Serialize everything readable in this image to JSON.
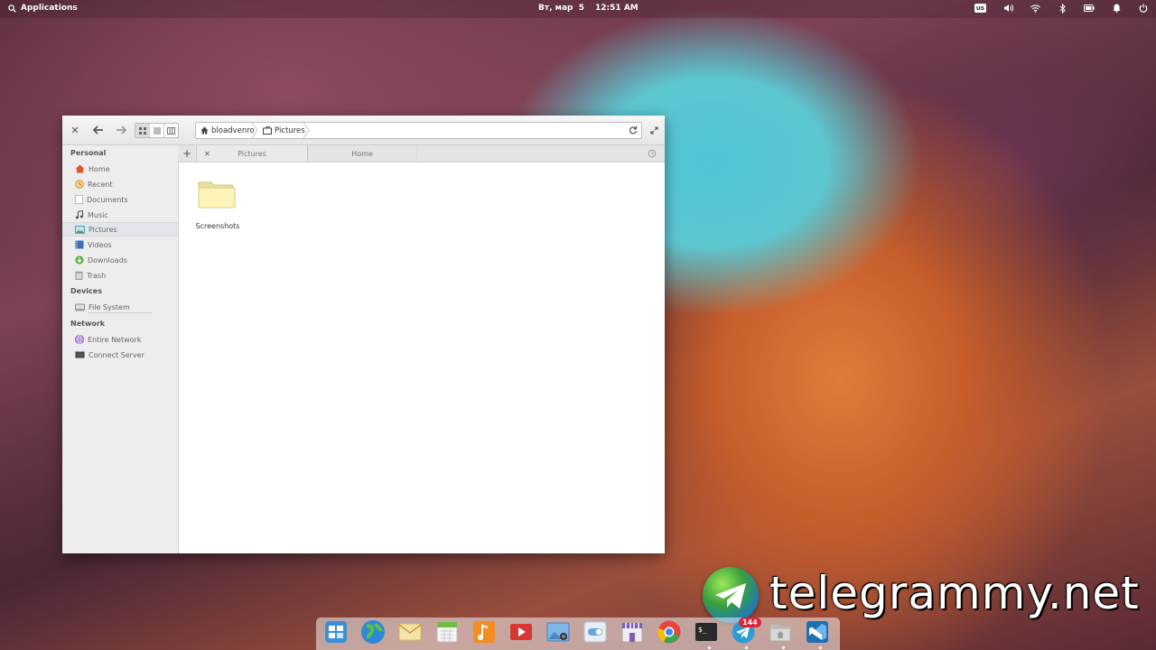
{
  "top_panel": {
    "applications_label": "Applications",
    "date": "Вт, мар  5",
    "time": "12:51 AM",
    "keyboard_layout": "us",
    "indicator_icons": [
      "volume-icon",
      "wifi-icon",
      "bluetooth-icon",
      "battery-icon",
      "notifications-icon",
      "power-icon"
    ]
  },
  "file_window": {
    "breadcrumbs": [
      "bloadvenro",
      "Pictures"
    ],
    "view_modes": [
      "grid-view-icon",
      "list-view-icon",
      "column-view-icon"
    ],
    "sidebar": {
      "sections": [
        {
          "heading": "Personal",
          "items": [
            {
              "label": "Home",
              "icon": "home-icon",
              "color": "#e0542e"
            },
            {
              "label": "Recent",
              "icon": "recent-icon",
              "color": "#e9a13b"
            },
            {
              "label": "Documents",
              "icon": "documents-icon",
              "color": "#ffffff"
            },
            {
              "label": "Music",
              "icon": "music-icon",
              "color": "#555555"
            },
            {
              "label": "Pictures",
              "icon": "pictures-icon",
              "color": "#4da6c9",
              "selected": true
            },
            {
              "label": "Videos",
              "icon": "videos-icon",
              "color": "#3d6fb5"
            },
            {
              "label": "Downloads",
              "icon": "downloads-icon",
              "color": "#5db340"
            },
            {
              "label": "Trash",
              "icon": "trash-icon",
              "color": "#9a9a9a"
            }
          ]
        },
        {
          "heading": "Devices",
          "items": [
            {
              "label": "File System",
              "icon": "drive-icon",
              "color": "#8a8a8a"
            }
          ]
        },
        {
          "heading": "Network",
          "items": [
            {
              "label": "Entire Network",
              "icon": "network-icon",
              "color": "#9b6fd0"
            },
            {
              "label": "Connect Server",
              "icon": "server-icon",
              "color": "#333333"
            }
          ]
        }
      ]
    },
    "tabs": [
      {
        "label": "Pictures",
        "active": true
      },
      {
        "label": "Home",
        "active": false
      }
    ],
    "files": [
      {
        "name": "Screenshots",
        "type": "folder"
      }
    ]
  },
  "watermark": {
    "text": "telegrammy.net"
  },
  "dock": {
    "apps": [
      {
        "name": "multitasking-view",
        "color": "#3b8fd6"
      },
      {
        "name": "web-browser-epiphany",
        "color": "#3fa23b"
      },
      {
        "name": "mail",
        "color": "#e6b94a"
      },
      {
        "name": "calendar",
        "color": "#6fbf44"
      },
      {
        "name": "music",
        "color": "#f28d23"
      },
      {
        "name": "videos",
        "color": "#d93636"
      },
      {
        "name": "photos",
        "color": "#4a8fd0"
      },
      {
        "name": "system-settings",
        "color": "#6aa6dc"
      },
      {
        "name": "app-center",
        "color": "#7b5fb8"
      },
      {
        "name": "google-chrome",
        "color": "#e8453c"
      },
      {
        "name": "terminal",
        "color": "#2a2a2a"
      },
      {
        "name": "telegram",
        "color": "#2b9bd8"
      },
      {
        "name": "files",
        "color": "#c9c9c9"
      },
      {
        "name": "visual-studio-code",
        "color": "#1f6fb5"
      }
    ],
    "telegram_badge": "144"
  }
}
